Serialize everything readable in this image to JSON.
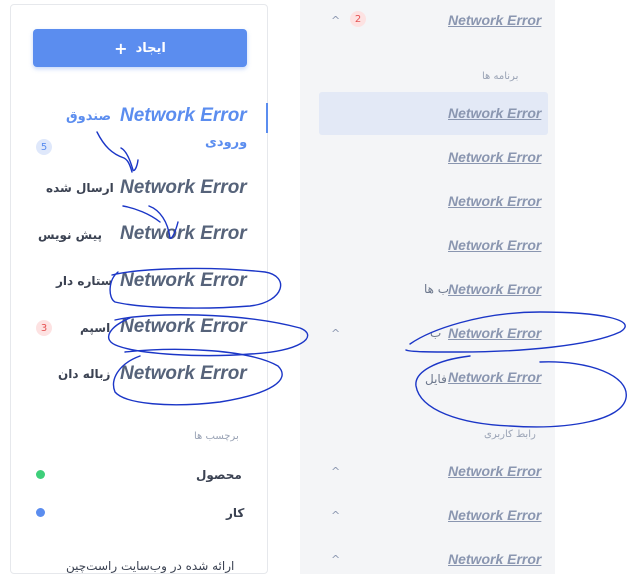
{
  "compose": {
    "label": "ایجاد",
    "icon": "plus-icon"
  },
  "folders": [
    {
      "error": "Network Error",
      "label": "صندوق",
      "label2": "ورودی",
      "badge": "5"
    },
    {
      "error": "Network Error",
      "label": "ارسال شده"
    },
    {
      "error": "Network Error",
      "label": "پیش نویس"
    },
    {
      "error": "Network Error",
      "label": "ستاره دار"
    },
    {
      "error": "Network Error",
      "label": "اسپم",
      "badge": "3"
    },
    {
      "error": "Network Error",
      "label": "زباله دان"
    }
  ],
  "tags": {
    "heading": "برچسب ها",
    "items": [
      {
        "label": "محصول",
        "color": "#3ecf7a"
      },
      {
        "label": "کار",
        "color": "#5b8def"
      }
    ]
  },
  "footer": {
    "text": "ارائه شده در وب‌سایت راست‌چین"
  },
  "sidebar": {
    "top": {
      "error": "Network Error",
      "badge": "2"
    },
    "section_apps": "برنامه ها",
    "apps": [
      {
        "error": "Network Error"
      },
      {
        "error": "Network Error"
      },
      {
        "error": "Network Error"
      },
      {
        "error": "Network Error"
      },
      {
        "error": "Network Error",
        "tail": "ب ها"
      },
      {
        "error": "Network Error",
        "tail": "ب"
      },
      {
        "error": "Network Error",
        "tail": "فایل"
      }
    ],
    "section_ui": "رابط کاربری",
    "ui": [
      {
        "error": "Network Error"
      },
      {
        "error": "Network Error"
      },
      {
        "error": "Network Error"
      }
    ]
  },
  "colors": {
    "accent": "#5b8def",
    "badge_red": "#e55353",
    "badge_blue": "#5b8def",
    "ink": "#1b36c7"
  }
}
